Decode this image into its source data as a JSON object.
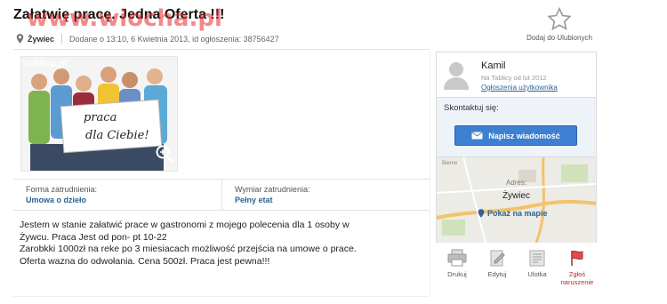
{
  "watermark": "www.wiocha.pl",
  "title": "Załatwię pracę. Jedna Oferta !!!",
  "meta": {
    "city": "Żywiec",
    "info": "Dodane o 13:10, 6 Kwietnia 2013, id ogłoszenia: 38756427"
  },
  "favorite": {
    "label": "Dodaj do Ulubionych",
    "icon": "star-icon"
  },
  "photo": {
    "brand": "tablica.pl",
    "sign_line1": "praca",
    "sign_line2": "dla Ciebie!",
    "zoom_icon": "zoom-icon"
  },
  "attributes": [
    {
      "label": "Forma zatrudnienia:",
      "value": "Umowa o dzieło"
    },
    {
      "label": "Wymiar zatrudnienia:",
      "value": "Pełny etat"
    }
  ],
  "description": [
    "Jestem w stanie załatwić prace w gastronomi z mojego polecenia dla 1 osoby w",
    "Żywcu. Praca Jest od pon- pt 10-22",
    "Zarobkki 1000zł na reke po 3 miesiacach możliwość przejścia na umowe o prace.",
    "Oferta wazna do odwołania. Cena 500zł. Praca jest pewna!!!"
  ],
  "seller": {
    "name": "Kamil",
    "since": "Na Tablicy od lut 2012",
    "ads_link": "Ogłoszenia użytkownika",
    "contact_heading": "Skontaktuj się:",
    "message_button": "Napisz wiadomość"
  },
  "map": {
    "top_label": "Bierne",
    "address_label": "Adres:",
    "city": "Żywiec",
    "show_link": "Pokaż na mapie"
  },
  "actions": [
    {
      "label": "Drukuj",
      "icon": "printer-icon"
    },
    {
      "label": "Edytuj",
      "icon": "edit-icon"
    },
    {
      "label": "Ulotka",
      "icon": "flyer-icon"
    },
    {
      "label": "Zgłoś naruszenie",
      "icon": "flag-icon"
    }
  ],
  "colors": {
    "link": "#2a6496",
    "button": "#3d7fd0",
    "contact_bg": "#eef3fa",
    "report": "#c0282a"
  }
}
